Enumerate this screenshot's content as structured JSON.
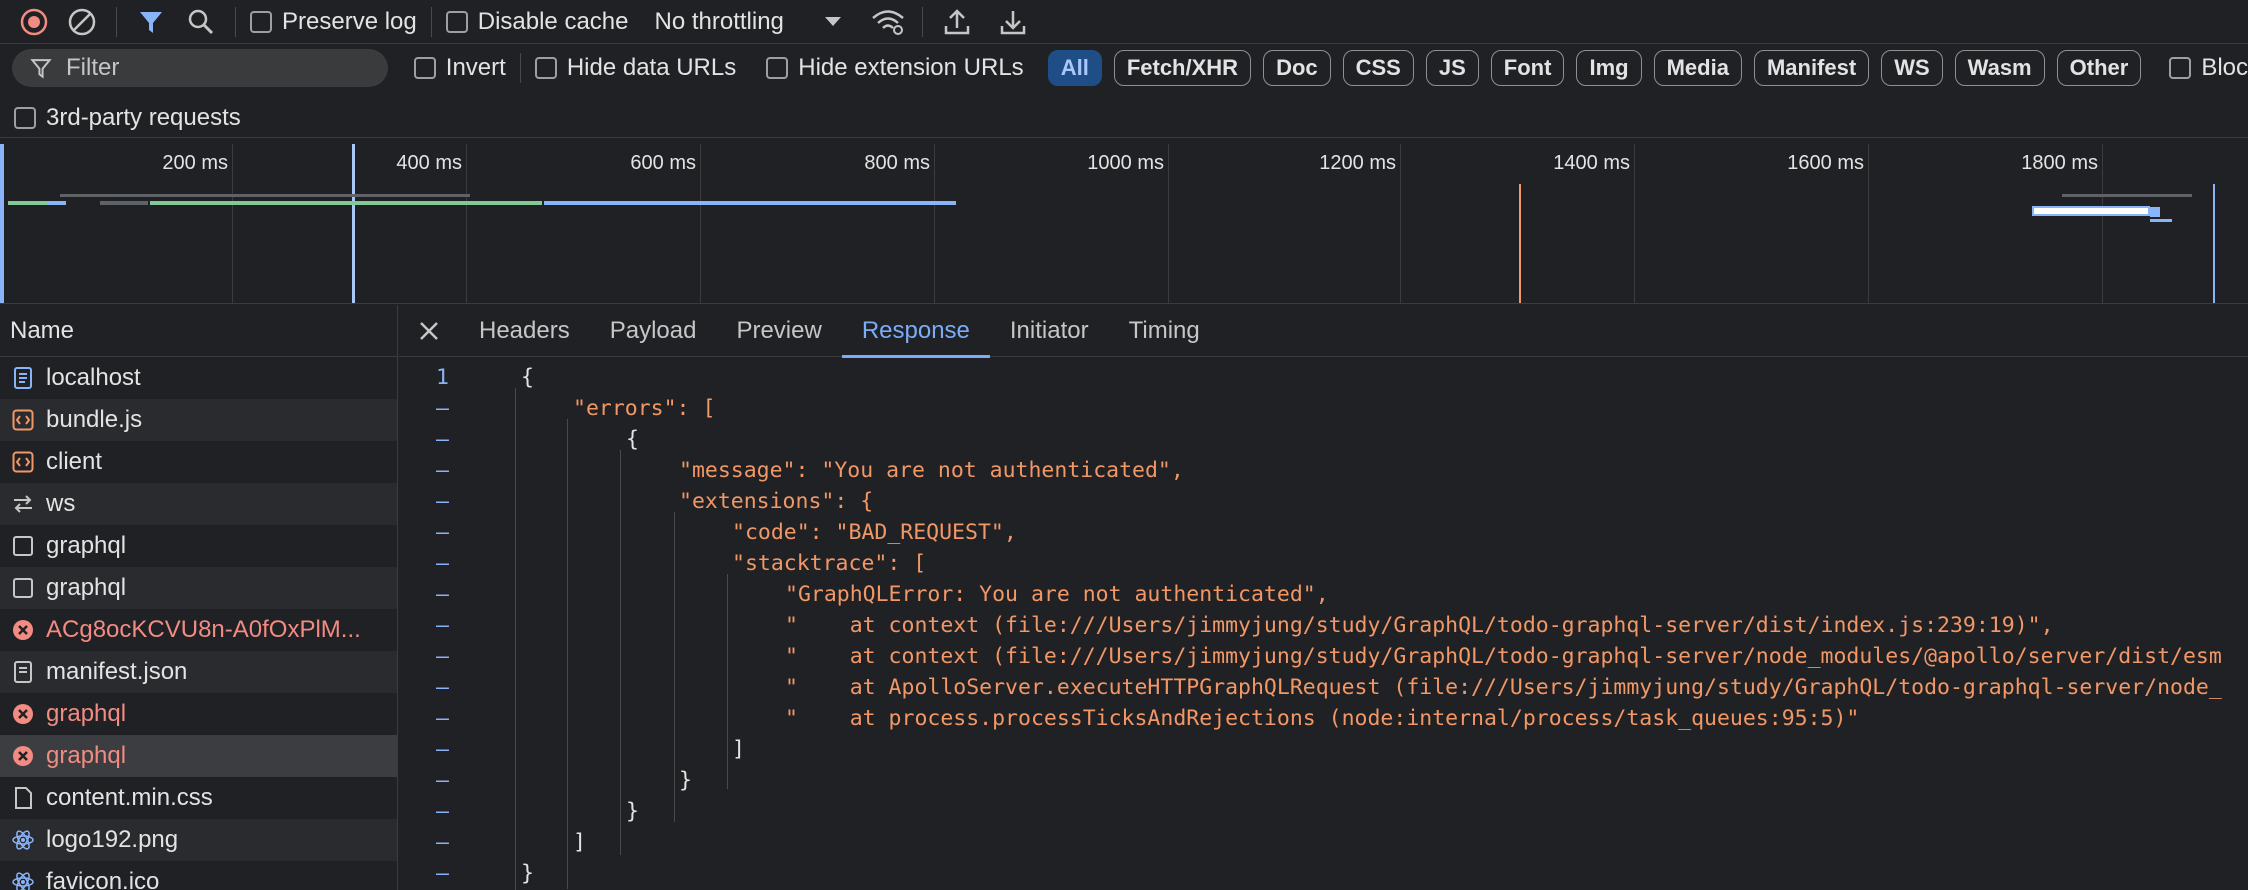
{
  "toolbar": {
    "preserve_log": "Preserve log",
    "disable_cache": "Disable cache",
    "throttling": "No throttling"
  },
  "filter": {
    "placeholder": "Filter",
    "invert": "Invert",
    "hide_data_urls": "Hide data URLs",
    "hide_extension_urls": "Hide extension URLs",
    "types": [
      "All",
      "Fetch/XHR",
      "Doc",
      "CSS",
      "JS",
      "Font",
      "Img",
      "Media",
      "Manifest",
      "WS",
      "Wasm",
      "Other"
    ],
    "blocked": "Bloc",
    "third_party": "3rd-party requests"
  },
  "timeline": {
    "ticks": [
      "200 ms",
      "400 ms",
      "600 ms",
      "800 ms",
      "1000 ms",
      "1200 ms",
      "1400 ms",
      "1600 ms",
      "1800 ms"
    ]
  },
  "requests": {
    "header": "Name",
    "items": [
      {
        "name": "localhost",
        "icon": "document-icon",
        "error": false
      },
      {
        "name": "bundle.js",
        "icon": "script-icon",
        "error": false
      },
      {
        "name": "client",
        "icon": "script-icon",
        "error": false
      },
      {
        "name": "ws",
        "icon": "websocket-icon",
        "error": false
      },
      {
        "name": "graphql",
        "icon": "fetch-icon",
        "error": false
      },
      {
        "name": "graphql",
        "icon": "fetch-icon",
        "error": false
      },
      {
        "name": "ACg8ocKCVU8n-A0fOxPlM...",
        "icon": "error-icon",
        "error": true
      },
      {
        "name": "manifest.json",
        "icon": "manifest-icon",
        "error": false
      },
      {
        "name": "graphql",
        "icon": "error-icon",
        "error": true
      },
      {
        "name": "graphql",
        "icon": "error-icon",
        "error": true,
        "selected": true
      },
      {
        "name": "content.min.css",
        "icon": "stylesheet-icon",
        "error": false
      },
      {
        "name": "logo192.png",
        "icon": "react-icon",
        "error": false
      },
      {
        "name": "favicon.ico",
        "icon": "react-icon",
        "error": false
      }
    ]
  },
  "tabs": [
    "Headers",
    "Payload",
    "Preview",
    "Response",
    "Initiator",
    "Timing"
  ],
  "active_tab": "Response",
  "response": {
    "first_line_number": "1",
    "fold_marker": "–",
    "lines": [
      "{",
      "\"errors\": [",
      "{",
      "\"message\": \"You are not authenticated\",",
      "\"extensions\": {",
      "\"code\": \"BAD_REQUEST\",",
      "\"stacktrace\": [",
      "\"GraphQLError: You are not authenticated\",",
      "\"    at context (file:///Users/jimmyjung/study/GraphQL/todo-graphql-server/dist/index.js:239:19)\",",
      "\"    at context (file:///Users/jimmyjung/study/GraphQL/todo-graphql-server/node_modules/@apollo/server/dist/esm",
      "\"    at ApolloServer.executeHTTPGraphQLRequest (file:///Users/jimmyjung/study/GraphQL/todo-graphql-server/node_",
      "\"    at process.processTicksAndRejections (node:internal/process/task_queues:95:5)\"",
      "]",
      "}",
      "}",
      "]",
      "}"
    ]
  },
  "colors": {
    "accent": "#7cacf8",
    "string": "#f29766",
    "error": "#f28b82"
  }
}
